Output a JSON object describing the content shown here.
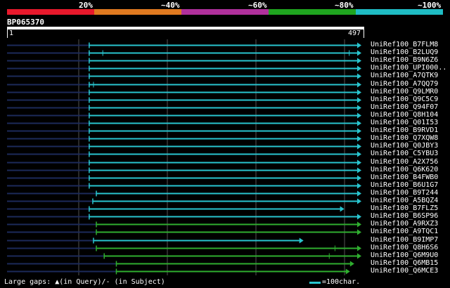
{
  "identity_scale": {
    "labels": [
      "20%",
      "~40%",
      "~60%",
      "~80%",
      "~100%"
    ],
    "colors": [
      "#e8192c",
      "#e07a20",
      "#b0309c",
      "#1fa51f",
      "#1fbcc4"
    ]
  },
  "query": {
    "id": "BP065370",
    "length_start": "1",
    "length_end": "497",
    "length": 497
  },
  "colors": {
    "cyan": "#29c5cf",
    "green": "#2fae2f",
    "navy": "#1c2a5a",
    "grid": "#555555"
  },
  "hits": [
    {
      "label": "UniRef100_B7FLM8",
      "start": 116,
      "end": 497,
      "color": "cyan",
      "arrow": true,
      "gap_marks": []
    },
    {
      "label": "UniRef100_B2LUQ9",
      "start": 116,
      "end": 497,
      "color": "cyan",
      "arrow": true,
      "gap_marks": [
        135,
        480
      ]
    },
    {
      "label": "UniRef100_B9N6Z6",
      "start": 116,
      "end": 497,
      "color": "cyan",
      "arrow": true,
      "gap_marks": []
    },
    {
      "label": "UniRef100_UPI000..",
      "start": 116,
      "end": 497,
      "color": "cyan",
      "arrow": true,
      "gap_marks": []
    },
    {
      "label": "UniRef100_A7QTK9",
      "start": 116,
      "end": 497,
      "color": "cyan",
      "arrow": true,
      "gap_marks": []
    },
    {
      "label": "UniRef100_A7QQ79",
      "start": 116,
      "end": 497,
      "color": "cyan",
      "arrow": true,
      "gap_marks": [
        122
      ]
    },
    {
      "label": "UniRef100_Q9LMR0",
      "start": 116,
      "end": 497,
      "color": "cyan",
      "arrow": true,
      "gap_marks": []
    },
    {
      "label": "UniRef100_Q9C5C9",
      "start": 116,
      "end": 497,
      "color": "cyan",
      "arrow": true,
      "gap_marks": []
    },
    {
      "label": "UniRef100_Q94F07",
      "start": 116,
      "end": 497,
      "color": "cyan",
      "arrow": true,
      "gap_marks": []
    },
    {
      "label": "UniRef100_Q8H104",
      "start": 116,
      "end": 497,
      "color": "cyan",
      "arrow": true,
      "gap_marks": []
    },
    {
      "label": "UniRef100_Q01I53",
      "start": 116,
      "end": 497,
      "color": "cyan",
      "arrow": true,
      "gap_marks": []
    },
    {
      "label": "UniRef100_B9RVD1",
      "start": 116,
      "end": 497,
      "color": "cyan",
      "arrow": true,
      "gap_marks": []
    },
    {
      "label": "UniRef100_Q7XQW8",
      "start": 116,
      "end": 497,
      "color": "cyan",
      "arrow": true,
      "gap_marks": []
    },
    {
      "label": "UniRef100_Q0JBY3",
      "start": 116,
      "end": 497,
      "color": "cyan",
      "arrow": true,
      "gap_marks": []
    },
    {
      "label": "UniRef100_C5YBU3",
      "start": 116,
      "end": 497,
      "color": "cyan",
      "arrow": true,
      "gap_marks": []
    },
    {
      "label": "UniRef100_A2X756",
      "start": 116,
      "end": 497,
      "color": "cyan",
      "arrow": true,
      "gap_marks": []
    },
    {
      "label": "UniRef100_Q6K620",
      "start": 116,
      "end": 497,
      "color": "cyan",
      "arrow": true,
      "gap_marks": []
    },
    {
      "label": "UniRef100_B4FWB0",
      "start": 116,
      "end": 497,
      "color": "cyan",
      "arrow": true,
      "gap_marks": []
    },
    {
      "label": "UniRef100_B6U1G7",
      "start": 116,
      "end": 497,
      "color": "cyan",
      "arrow": true,
      "gap_marks": []
    },
    {
      "label": "UniRef100_B9T244",
      "start": 126,
      "end": 497,
      "color": "cyan",
      "arrow": true,
      "gap_marks": []
    },
    {
      "label": "UniRef100_A5BQZ4",
      "start": 121,
      "end": 497,
      "color": "cyan",
      "arrow": true,
      "gap_marks": []
    },
    {
      "label": "UniRef100_B7FLZ5",
      "start": 116,
      "end": 473,
      "color": "cyan",
      "arrow": true,
      "gap_marks": []
    },
    {
      "label": "UniRef100_B6SP96",
      "start": 116,
      "end": 497,
      "color": "cyan",
      "arrow": true,
      "gap_marks": []
    },
    {
      "label": "UniRef100_A9RXZ3",
      "start": 126,
      "end": 497,
      "color": "green",
      "arrow": true,
      "gap_marks": []
    },
    {
      "label": "UniRef100_A9TQC1",
      "start": 126,
      "end": 497,
      "color": "green",
      "arrow": true,
      "gap_marks": []
    },
    {
      "label": "UniRef100_B9IMP7",
      "start": 122,
      "end": 416,
      "color": "cyan",
      "arrow": true,
      "gap_marks": []
    },
    {
      "label": "UniRef100_Q8H6S6",
      "start": 126,
      "end": 497,
      "color": "green",
      "arrow": true,
      "gap_marks": [
        460
      ]
    },
    {
      "label": "UniRef100_Q6M9U0",
      "start": 137,
      "end": 497,
      "color": "green",
      "arrow": true,
      "gap_marks": [
        452
      ]
    },
    {
      "label": "UniRef100_Q6MB15",
      "start": 154,
      "end": 487,
      "color": "green",
      "arrow": true,
      "gap_marks": []
    },
    {
      "label": "UniRef100_Q6MCE3",
      "start": 154,
      "end": 481,
      "color": "green",
      "arrow": true,
      "gap_marks": []
    }
  ],
  "footer": {
    "gaps_text": "Large gaps: ▲(in Query)/‐ (in Subject)",
    "scale_text": "=100char."
  }
}
